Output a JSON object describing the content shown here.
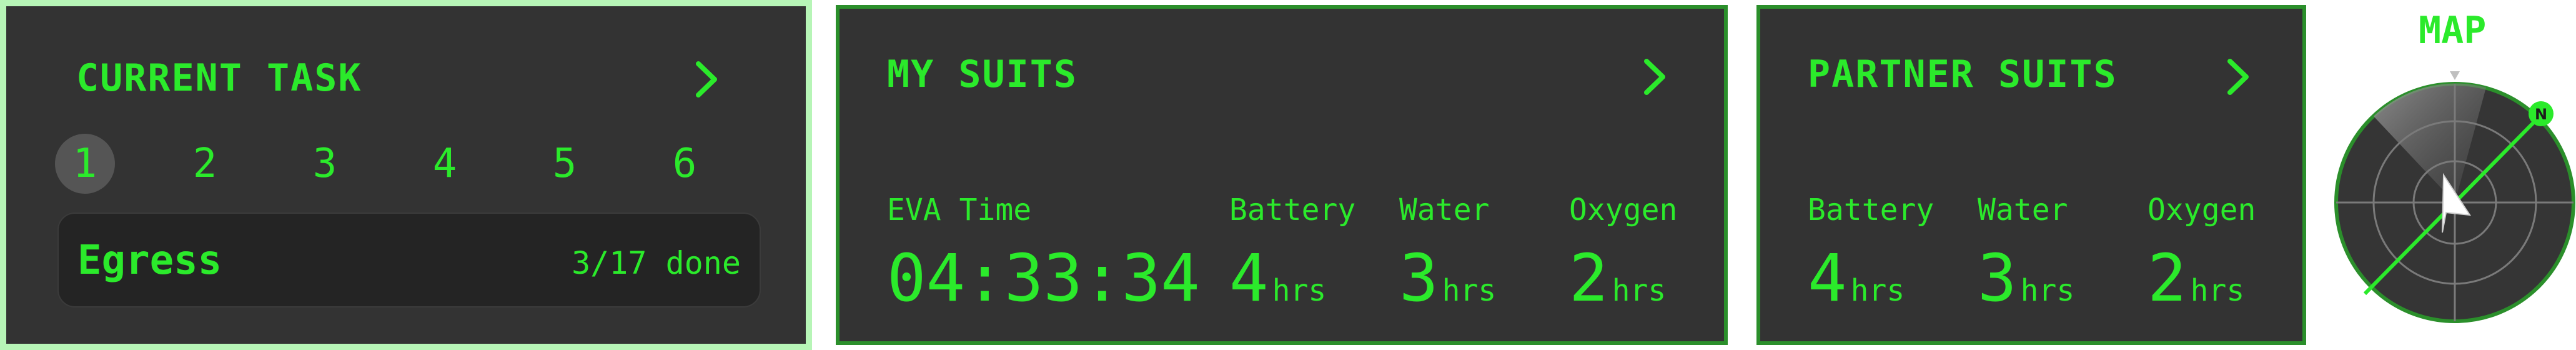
{
  "current_task": {
    "title": "CURRENT TASK",
    "steps": [
      "1",
      "2",
      "3",
      "4",
      "5",
      "6"
    ],
    "active_step": "1",
    "task_name": "Egress",
    "progress": "3/17 done"
  },
  "my_suits": {
    "title": "MY SUITS",
    "eva_label": "EVA Time",
    "eva_value": "04:33:34",
    "battery_label": "Battery",
    "battery_value": "4",
    "water_label": "Water",
    "water_value": "3",
    "oxygen_label": "Oxygen",
    "oxygen_value": "2",
    "unit": "hrs"
  },
  "partner_suits": {
    "title": "PARTNER SUITS",
    "battery_label": "Battery",
    "battery_value": "4",
    "water_label": "Water",
    "water_value": "3",
    "oxygen_label": "Oxygen",
    "oxygen_value": "2",
    "unit": "hrs"
  },
  "map": {
    "title": "MAP",
    "north_label": "N"
  },
  "colors": {
    "accent": "#2bea2b",
    "panel_bg": "#333333",
    "panel_border": "#2b8f2b",
    "active_panel_border": "#b7f5b7"
  },
  "icons": {
    "chevron": "chevron-right-icon",
    "heading": "navigation-arrow-icon"
  }
}
